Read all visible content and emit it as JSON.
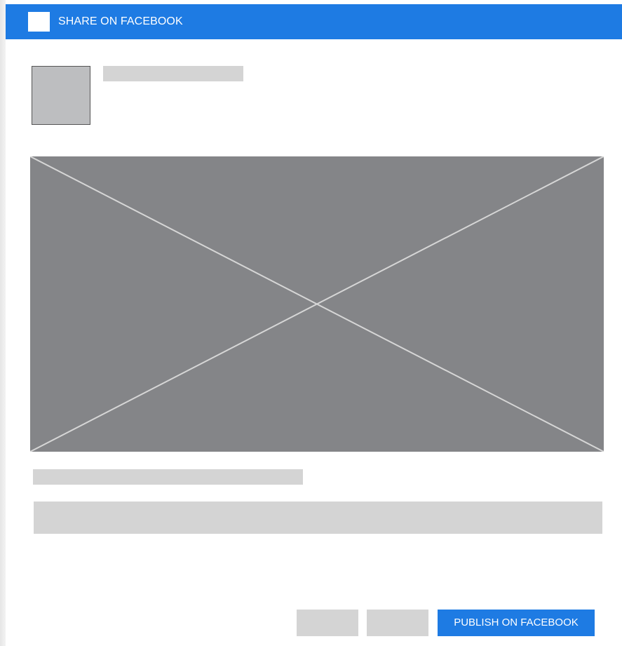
{
  "header": {
    "title": "SHARE ON FACEBOOK",
    "icon": "facebook-logo-icon"
  },
  "actions": {
    "publish_label": "PUBLISH ON FACEBOOK"
  },
  "colors": {
    "accent": "#1e7be3",
    "placeholder": "#d4d4d4",
    "image_placeholder": "#848588",
    "avatar": "#bdbec0"
  }
}
